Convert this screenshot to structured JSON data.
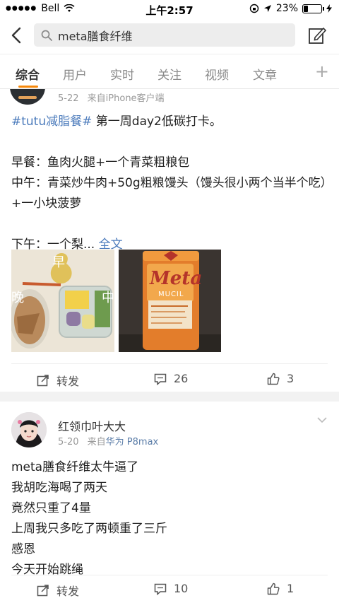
{
  "status_bar": {
    "carrier": "Bell",
    "time": "上午2:57",
    "battery_percent": "23%"
  },
  "search": {
    "query": "meta膳食纤维"
  },
  "tabs": [
    {
      "label": "综合",
      "active": true
    },
    {
      "label": "用户",
      "active": false
    },
    {
      "label": "实时",
      "active": false
    },
    {
      "label": "关注",
      "active": false
    },
    {
      "label": "视频",
      "active": false
    },
    {
      "label": "文章",
      "active": false
    }
  ],
  "post1": {
    "date": "5-22",
    "source_prefix": "来自",
    "source": "iPhone客户端",
    "hashtag": "#tutu减脂餐#",
    "title_rest": " 第一周day2低碳打卡。",
    "line_breakfast": "早餐：鱼肉火腿+一个青菜粗粮包",
    "line_lunch": "中午：青菜炒牛肉+50g粗粮馒头（馒头很小两个当半个吃）+一小块菠萝",
    "line_afternoon": "下午：一个梨...",
    "full_text_link": "全文",
    "photo1_labels": {
      "morning": "早",
      "evening": "晚",
      "noon": "中"
    },
    "photo2_brand": "Meta",
    "photo2_sub": "MUCIL",
    "actions": {
      "repost": "转发",
      "comments": "26",
      "likes": "3"
    }
  },
  "post2": {
    "author": "红领巾叶大大",
    "date": "5-20",
    "source_prefix": "来自",
    "source": "华为 P8max",
    "lines": [
      "meta膳食纤维太牛逼了",
      "我胡吃海喝了两天",
      "竟然只重了4量",
      "上周我只多吃了两顿重了三斤",
      "感恩",
      "今天开始跳绳"
    ],
    "actions": {
      "repost": "转发",
      "comments": "10",
      "likes": "1"
    }
  },
  "colors": {
    "accent": "#f7890c",
    "link": "#4d7cbc",
    "meta_text": "#999999"
  }
}
